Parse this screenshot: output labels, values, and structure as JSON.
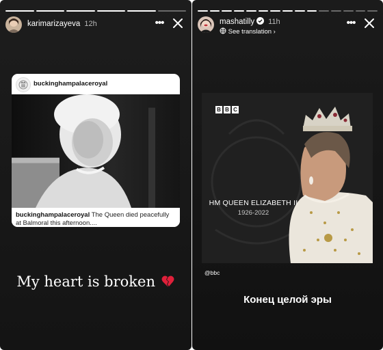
{
  "left_story": {
    "username": "karimarizayeva",
    "time": "12h",
    "progress_segments": [
      1,
      1,
      1,
      1,
      1,
      0
    ],
    "repost": {
      "account": "buckinghampalaceroyal",
      "caption_user": "buckinghampalaceroyal",
      "caption_text": " The Queen died peacefully at Balmoral this afternoon...."
    },
    "text": "My heart is broken",
    "emoji": "broken-heart-icon"
  },
  "right_story": {
    "username": "mashatilly",
    "verified": true,
    "time": "11h",
    "translation_link": "See translation",
    "progress_segments": [
      1,
      1,
      1,
      1,
      1,
      1,
      1,
      1,
      1,
      1,
      0,
      0,
      0,
      0,
      0
    ],
    "card": {
      "logo_letters": [
        "B",
        "B",
        "C"
      ],
      "name": "HM QUEEN ELIZABETH II",
      "years": "1926-2022"
    },
    "mention": "@bbc",
    "caption": "Конец целой эры"
  },
  "colors": {
    "story_bg": "#161616",
    "text": "#ffffff",
    "heart_red": "#e0203a"
  }
}
